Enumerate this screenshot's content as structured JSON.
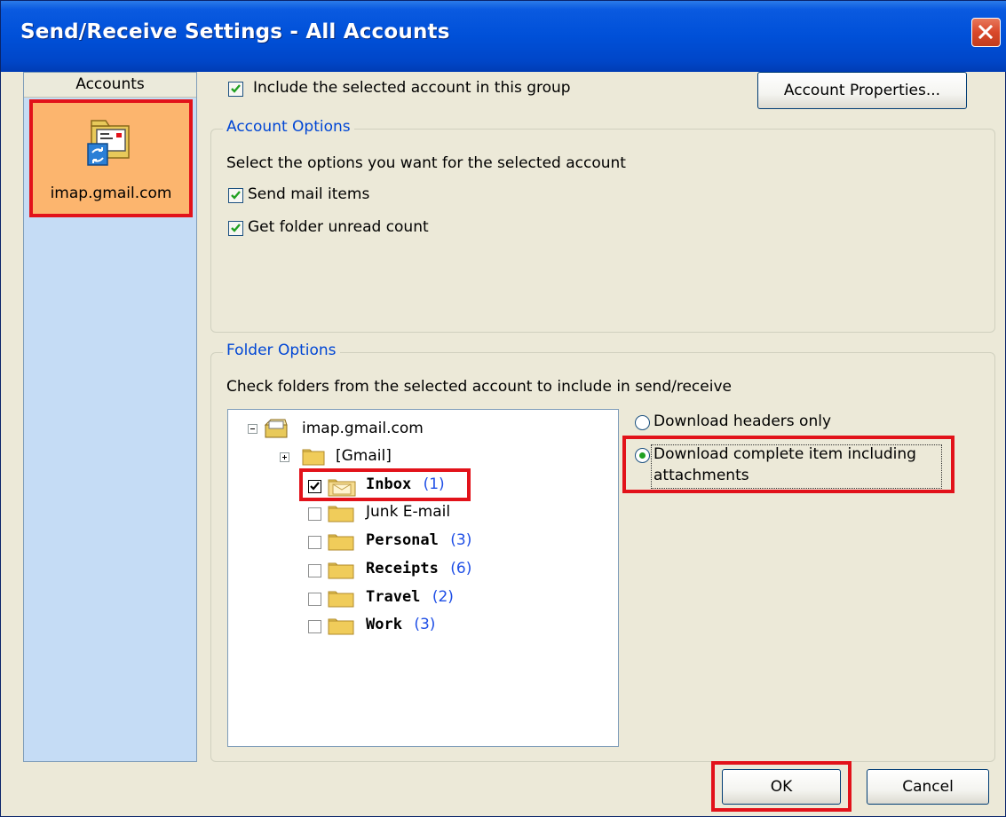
{
  "window": {
    "title": "Send/Receive Settings - All Accounts"
  },
  "accounts": {
    "header": "Accounts",
    "items": [
      {
        "label": "imap.gmail.com",
        "selected": true
      }
    ]
  },
  "top": {
    "include_checkbox_label": "Include the selected account in this group",
    "include_checked": true,
    "account_properties_button": "Account Properties..."
  },
  "account_options": {
    "title": "Account Options",
    "description": "Select the options you want for the selected account",
    "send_mail_label": "Send mail items",
    "send_mail_checked": true,
    "unread_count_label": "Get folder unread count",
    "unread_count_checked": true
  },
  "folder_options": {
    "title": "Folder Options",
    "description": "Check folders from the selected account to include in send/receive",
    "tree": {
      "root": "imap.gmail.com",
      "gmail": "[Gmail]",
      "folders": [
        {
          "name": "Inbox",
          "count": "(1)",
          "checked": true,
          "bold": true
        },
        {
          "name": "Junk E-mail",
          "count": "",
          "checked": false,
          "bold": false
        },
        {
          "name": "Personal",
          "count": "(3)",
          "checked": false,
          "bold": true
        },
        {
          "name": "Receipts",
          "count": "(6)",
          "checked": false,
          "bold": true
        },
        {
          "name": "Travel",
          "count": "(2)",
          "checked": false,
          "bold": true
        },
        {
          "name": "Work",
          "count": "(3)",
          "checked": false,
          "bold": true
        }
      ]
    },
    "radio_headers_only": "Download headers only",
    "radio_complete_line1": "Download complete item including",
    "radio_complete_line2": "attachments",
    "selected_option": "complete"
  },
  "buttons": {
    "ok": "OK",
    "cancel": "Cancel"
  },
  "colors": {
    "title_bar": "#0050d8",
    "highlight_box": "#e2121a",
    "selected_account": "#fcb56e",
    "accounts_panel": "#c5dcf5",
    "group_title": "#0046d5",
    "unread_count": "#1f4fe6"
  }
}
